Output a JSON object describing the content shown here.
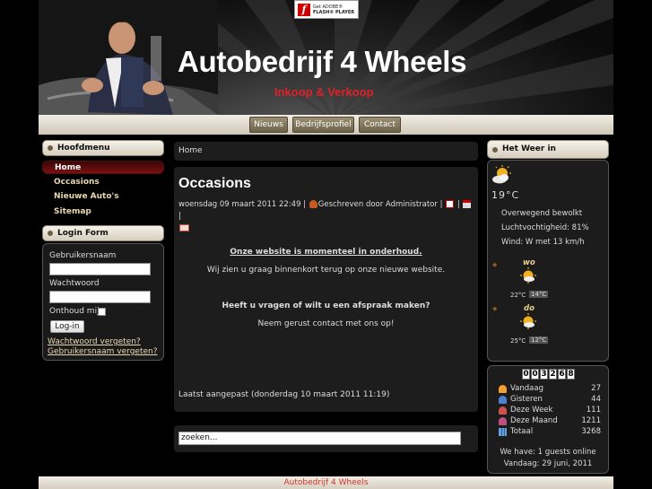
{
  "header": {
    "site_title": "Autobedrijf 4 Wheels",
    "site_subtitle": "Inkoop & Verkoop",
    "flash_badge": {
      "line1": "Get ADOBE®",
      "line2": "FLASH® PLAYER"
    }
  },
  "nav": {
    "items": [
      {
        "label": "Nieuws"
      },
      {
        "label": "Bedrijfsprofiel"
      },
      {
        "label": "Contact"
      }
    ]
  },
  "main_menu": {
    "title": "Hoofdmenu",
    "items": [
      {
        "label": "Home",
        "active": true
      },
      {
        "label": "Occasions"
      },
      {
        "label": "Nieuwe Auto's"
      },
      {
        "label": "Sitemap"
      }
    ]
  },
  "login": {
    "title": "Login Form",
    "username_label": "Gebruikersnaam",
    "password_label": "Wachtwoord",
    "remember_label": "Onthoud mij",
    "submit_label": "Log-in",
    "forgot_password": "Wachtwoord vergeten?",
    "forgot_username": "Gebruikersnaam vergeten?"
  },
  "breadcrumb": "Home",
  "article": {
    "title": "Occasions",
    "meta_date": "woensdag 09 maart 2011 22:49 |",
    "meta_author": "Geschreven door Administrator |",
    "notice_heading": "Onze website is momenteel in onderhoud.",
    "notice_text": "Wij zien u graag binnenkort terug op onze nieuwe website.",
    "question": "Heeft u vragen of wilt u een afspraak maken?",
    "contact_text": "Neem gerust contact met ons op!",
    "last_modified": "Laatst aangepast (donderdag 10 maart 2011 11:19)"
  },
  "search": {
    "placeholder": "zoeken..."
  },
  "weather": {
    "title": "Het Weer in \"Amsterdam\"",
    "temperature": "19°C",
    "condition": "Overwegend bewolkt",
    "humidity": "Luchtvochtigheid: 81%",
    "wind": "Wind: W met 13 km/h",
    "forecast": [
      {
        "day": "wo",
        "high": "22°C",
        "low": "14°C"
      },
      {
        "day": "do",
        "high": "25°C",
        "low": "12°C"
      }
    ]
  },
  "counter": {
    "digits": [
      "0",
      "0",
      "3",
      "2",
      "6",
      "8"
    ],
    "rows": [
      {
        "label": "Vandaag",
        "value": "27"
      },
      {
        "label": "Gisteren",
        "value": "44"
      },
      {
        "label": "Deze Week",
        "value": "111"
      },
      {
        "label": "Deze Maand",
        "value": "1211"
      },
      {
        "label": "Totaal",
        "value": "3268"
      }
    ],
    "guests": "We have: 1 guests online",
    "date": "Vandaag: 29 juni, 2011"
  },
  "footer": {
    "text": "Autobedrijf 4 Wheels"
  }
}
